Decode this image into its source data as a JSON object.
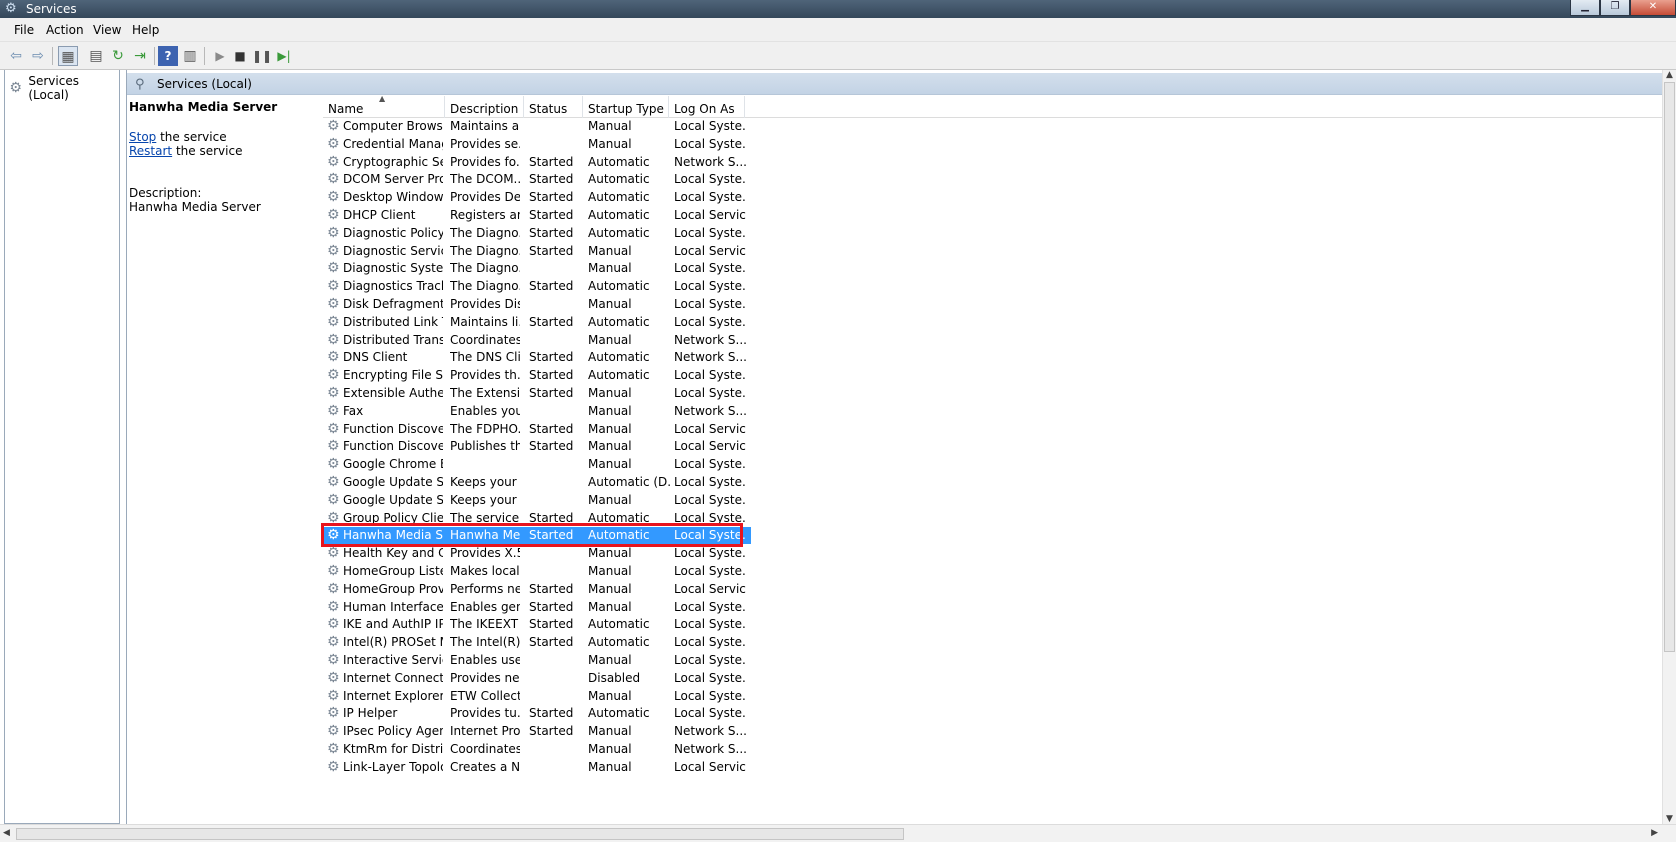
{
  "window": {
    "title": "Services"
  },
  "menu": {
    "file": "File",
    "action": "Action",
    "view": "View",
    "help": "Help"
  },
  "tree": {
    "root": "Services (Local)"
  },
  "pane": {
    "title": "Services (Local)",
    "selected_name": "Hanwha Media Server",
    "stop_link": "Stop",
    "stop_rest": " the service",
    "restart_link": "Restart",
    "restart_rest": " the service",
    "desc_label": "Description:",
    "desc_text": "Hanwha Media Server"
  },
  "columns": {
    "name": "Name",
    "description": "Description",
    "status": "Status",
    "startup": "Startup Type",
    "logon": "Log On As"
  },
  "services": [
    {
      "name": "Computer Browser",
      "desc": "Maintains a...",
      "status": "",
      "startup": "Manual",
      "logon": "Local Syste..."
    },
    {
      "name": "Credential Manager",
      "desc": "Provides se...",
      "status": "",
      "startup": "Manual",
      "logon": "Local Syste..."
    },
    {
      "name": "Cryptographic Ser...",
      "desc": "Provides fo...",
      "status": "Started",
      "startup": "Automatic",
      "logon": "Network S..."
    },
    {
      "name": "DCOM Server Pro...",
      "desc": "The DCOM...",
      "status": "Started",
      "startup": "Automatic",
      "logon": "Local Syste..."
    },
    {
      "name": "Desktop Window ...",
      "desc": "Provides De...",
      "status": "Started",
      "startup": "Automatic",
      "logon": "Local Syste..."
    },
    {
      "name": "DHCP Client",
      "desc": "Registers an...",
      "status": "Started",
      "startup": "Automatic",
      "logon": "Local Service"
    },
    {
      "name": "Diagnostic Policy ...",
      "desc": "The Diagno...",
      "status": "Started",
      "startup": "Automatic",
      "logon": "Local Syste..."
    },
    {
      "name": "Diagnostic Service...",
      "desc": "The Diagno...",
      "status": "Started",
      "startup": "Manual",
      "logon": "Local Service"
    },
    {
      "name": "Diagnostic System...",
      "desc": "The Diagno...",
      "status": "",
      "startup": "Manual",
      "logon": "Local Syste..."
    },
    {
      "name": "Diagnostics Tracki...",
      "desc": "The Diagno...",
      "status": "Started",
      "startup": "Automatic",
      "logon": "Local Syste..."
    },
    {
      "name": "Disk Defragmenter",
      "desc": "Provides Dis...",
      "status": "",
      "startup": "Manual",
      "logon": "Local Syste..."
    },
    {
      "name": "Distributed Link Tr...",
      "desc": "Maintains li...",
      "status": "Started",
      "startup": "Automatic",
      "logon": "Local Syste..."
    },
    {
      "name": "Distributed Transa...",
      "desc": "Coordinates...",
      "status": "",
      "startup": "Manual",
      "logon": "Network S..."
    },
    {
      "name": "DNS Client",
      "desc": "The DNS Cli...",
      "status": "Started",
      "startup": "Automatic",
      "logon": "Network S..."
    },
    {
      "name": "Encrypting File Sy...",
      "desc": "Provides th...",
      "status": "Started",
      "startup": "Automatic",
      "logon": "Local Syste..."
    },
    {
      "name": "Extensible Authen...",
      "desc": "The Extensi...",
      "status": "Started",
      "startup": "Manual",
      "logon": "Local Syste..."
    },
    {
      "name": "Fax",
      "desc": "Enables you...",
      "status": "",
      "startup": "Manual",
      "logon": "Network S..."
    },
    {
      "name": "Function Discover...",
      "desc": "The FDPHO...",
      "status": "Started",
      "startup": "Manual",
      "logon": "Local Service"
    },
    {
      "name": "Function Discover...",
      "desc": "Publishes th...",
      "status": "Started",
      "startup": "Manual",
      "logon": "Local Service"
    },
    {
      "name": "Google Chrome El...",
      "desc": "",
      "status": "",
      "startup": "Manual",
      "logon": "Local Syste..."
    },
    {
      "name": "Google Update Se...",
      "desc": "Keeps your ...",
      "status": "",
      "startup": "Automatic (D...",
      "logon": "Local Syste..."
    },
    {
      "name": "Google Update Se...",
      "desc": "Keeps your ...",
      "status": "",
      "startup": "Manual",
      "logon": "Local Syste..."
    },
    {
      "name": "Group Policy Client",
      "desc": "The service ...",
      "status": "Started",
      "startup": "Automatic",
      "logon": "Local Syste..."
    },
    {
      "name": "Hanwha Media Se...",
      "desc": "Hanwha Me...",
      "status": "Started",
      "startup": "Automatic",
      "logon": "Local Syste..."
    },
    {
      "name": "Health Key and Ce...",
      "desc": "Provides X.5...",
      "status": "",
      "startup": "Manual",
      "logon": "Local Syste..."
    },
    {
      "name": "HomeGroup Liste...",
      "desc": "Makes local...",
      "status": "",
      "startup": "Manual",
      "logon": "Local Syste..."
    },
    {
      "name": "HomeGroup Provi...",
      "desc": "Performs ne...",
      "status": "Started",
      "startup": "Manual",
      "logon": "Local Service"
    },
    {
      "name": "Human Interface ...",
      "desc": "Enables gen...",
      "status": "Started",
      "startup": "Manual",
      "logon": "Local Syste..."
    },
    {
      "name": "IKE and AuthIP IPs...",
      "desc": "The IKEEXT ...",
      "status": "Started",
      "startup": "Automatic",
      "logon": "Local Syste..."
    },
    {
      "name": "Intel(R) PROSet M...",
      "desc": "The Intel(R) ...",
      "status": "Started",
      "startup": "Automatic",
      "logon": "Local Syste..."
    },
    {
      "name": "Interactive Service...",
      "desc": "Enables use...",
      "status": "",
      "startup": "Manual",
      "logon": "Local Syste..."
    },
    {
      "name": "Internet Connecti...",
      "desc": "Provides ne...",
      "status": "",
      "startup": "Disabled",
      "logon": "Local Syste..."
    },
    {
      "name": "Internet Explorer E...",
      "desc": "ETW Collect...",
      "status": "",
      "startup": "Manual",
      "logon": "Local Syste..."
    },
    {
      "name": "IP Helper",
      "desc": "Provides tu...",
      "status": "Started",
      "startup": "Automatic",
      "logon": "Local Syste..."
    },
    {
      "name": "IPsec Policy Agent",
      "desc": "Internet Pro...",
      "status": "Started",
      "startup": "Manual",
      "logon": "Network S..."
    },
    {
      "name": "KtmRm for Distrib...",
      "desc": "Coordinates...",
      "status": "",
      "startup": "Manual",
      "logon": "Network S..."
    },
    {
      "name": "Link-Layer Topolo...",
      "desc": "Creates a N...",
      "status": "",
      "startup": "Manual",
      "logon": "Local Service"
    }
  ],
  "selected_index": 23,
  "colors": {
    "selection": "#3399ff",
    "highlight_box": "#e8141e",
    "link": "#0645ad"
  }
}
